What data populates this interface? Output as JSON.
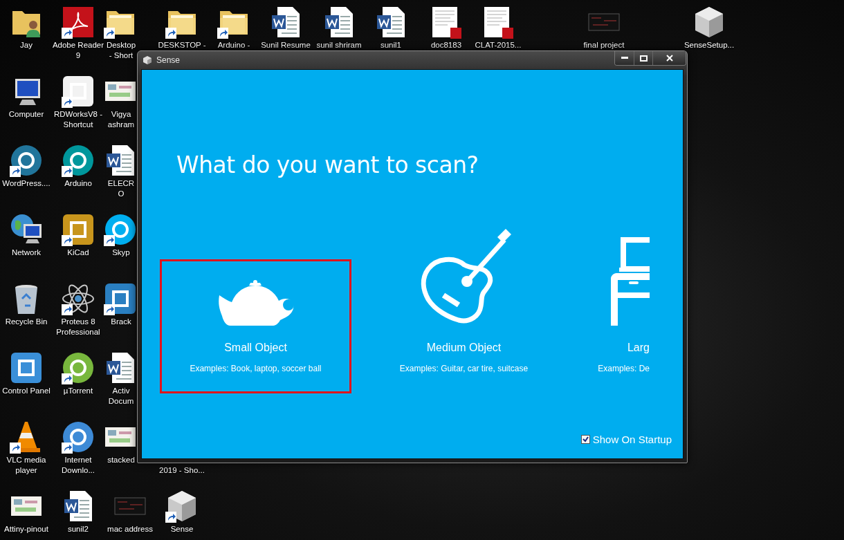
{
  "desktop_icons": [
    {
      "label": "Jay",
      "kind": "user-folder",
      "shortcut": false
    },
    {
      "label": "Adobe Reader 9",
      "kind": "pdf-app",
      "shortcut": true
    },
    {
      "label": "Desktop - Short",
      "kind": "folder",
      "shortcut": true
    },
    {
      "label": "DESKSTOP -",
      "kind": "folder",
      "shortcut": true
    },
    {
      "label": "Arduino -",
      "kind": "folder",
      "shortcut": true
    },
    {
      "label": "Sunil Resume",
      "kind": "word",
      "shortcut": false
    },
    {
      "label": "sunil shriram",
      "kind": "word",
      "shortcut": false
    },
    {
      "label": "sunil1",
      "kind": "word",
      "shortcut": false
    },
    {
      "label": "doc8183",
      "kind": "pdf-doc",
      "shortcut": false
    },
    {
      "label": "CLAT-2015...",
      "kind": "pdf-doc",
      "shortcut": false
    },
    {
      "label": "final project",
      "kind": "dark-thumbnail",
      "shortcut": false
    },
    {
      "label": "SenseSetup...",
      "kind": "cube",
      "shortcut": false
    },
    {
      "label": "Computer",
      "kind": "monitor",
      "shortcut": false
    },
    {
      "label": "RDWorksV8 - Shortcut",
      "kind": "square",
      "color": "#f2f2f2",
      "shortcut": true
    },
    {
      "label": "Vigya ashram",
      "kind": "thumbnail",
      "shortcut": false
    },
    {
      "label": "WordPress....",
      "kind": "round",
      "color": "#21759b",
      "shortcut": true
    },
    {
      "label": "Arduino",
      "kind": "round",
      "color": "#00979c",
      "shortcut": true
    },
    {
      "label": "ELECRO",
      "kind": "word",
      "shortcut": false
    },
    {
      "label": "Network",
      "kind": "globe-monitor",
      "shortcut": false
    },
    {
      "label": "KiCad",
      "kind": "square",
      "color": "#c8951c",
      "shortcut": true
    },
    {
      "label": "Skyp",
      "kind": "round",
      "color": "#00aff0",
      "shortcut": true
    },
    {
      "label": "Recycle Bin",
      "kind": "bin",
      "shortcut": false
    },
    {
      "label": "Proteus 8 Professional",
      "kind": "atom",
      "shortcut": true
    },
    {
      "label": "Brack",
      "kind": "square",
      "color": "#2a7fc1",
      "shortcut": true
    },
    {
      "label": "Control Panel",
      "kind": "square",
      "color": "#3a8fd8",
      "shortcut": false
    },
    {
      "label": "µTorrent",
      "kind": "round",
      "color": "#78b73d",
      "shortcut": true
    },
    {
      "label": "Activ Docum",
      "kind": "word",
      "shortcut": false
    },
    {
      "label": "VLC media player",
      "kind": "cone",
      "shortcut": true
    },
    {
      "label": "Internet Downlo...",
      "kind": "round",
      "color": "#3d8ad6",
      "shortcut": true
    },
    {
      "label": "stacked",
      "kind": "thumbnail",
      "shortcut": false
    },
    {
      "label": "2019 - Sho...",
      "kind": "hidden",
      "shortcut": false
    },
    {
      "label": "Attiny-pinout",
      "kind": "thumbnail",
      "shortcut": false
    },
    {
      "label": "sunil2",
      "kind": "word",
      "shortcut": false
    },
    {
      "label": "mac address",
      "kind": "dark-thumbnail",
      "shortcut": false
    },
    {
      "label": "Sense",
      "kind": "cube",
      "shortcut": true
    }
  ],
  "window": {
    "title": "Sense",
    "heading": "What do you want to scan?",
    "cards": [
      {
        "kind": "teapot",
        "title": "Small Object",
        "examples": "Examples: Book, laptop, soccer ball",
        "selected": true
      },
      {
        "kind": "guitar",
        "title": "Medium Object",
        "examples": "Examples: Guitar, car tire, suitcase",
        "selected": false
      },
      {
        "kind": "desk",
        "title": "Larg",
        "examples": "Examples: De",
        "selected": false
      }
    ],
    "show_on_startup": {
      "label": "Show On Startup",
      "checked": true
    }
  }
}
